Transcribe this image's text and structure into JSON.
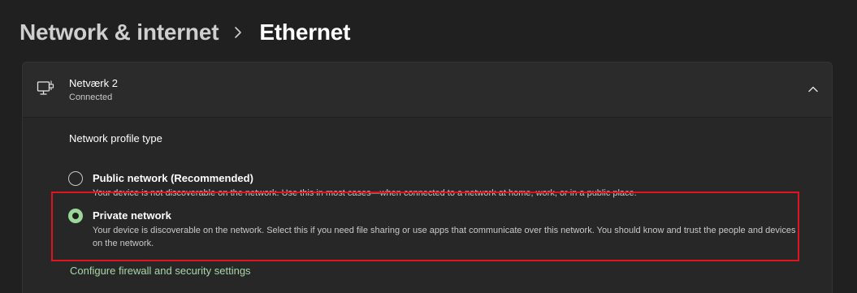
{
  "breadcrumb": {
    "parent": "Network & internet",
    "current": "Ethernet"
  },
  "connection": {
    "name": "Netværk 2",
    "status": "Connected",
    "icon": "ethernet-monitor-icon",
    "expand_icon": "chevron-up-icon"
  },
  "profile": {
    "title": "Network profile type",
    "options": [
      {
        "label": "Public network (Recommended)",
        "description": "Your device is not discoverable on the network. Use this in most cases—when connected to a network at home, work, or in a public place.",
        "selected": false
      },
      {
        "label": "Private network",
        "description": "Your device is discoverable on the network. Select this if you need file sharing or use apps that communicate over this network. You should know and trust the people and devices on the network.",
        "selected": true
      }
    ]
  },
  "firewall_link": "Configure firewall and security settings",
  "colors": {
    "background": "#202020",
    "card": "#2b2b2b",
    "accent": "#9bd79b",
    "link": "#a6d8a6",
    "highlight": "#e0141e"
  }
}
